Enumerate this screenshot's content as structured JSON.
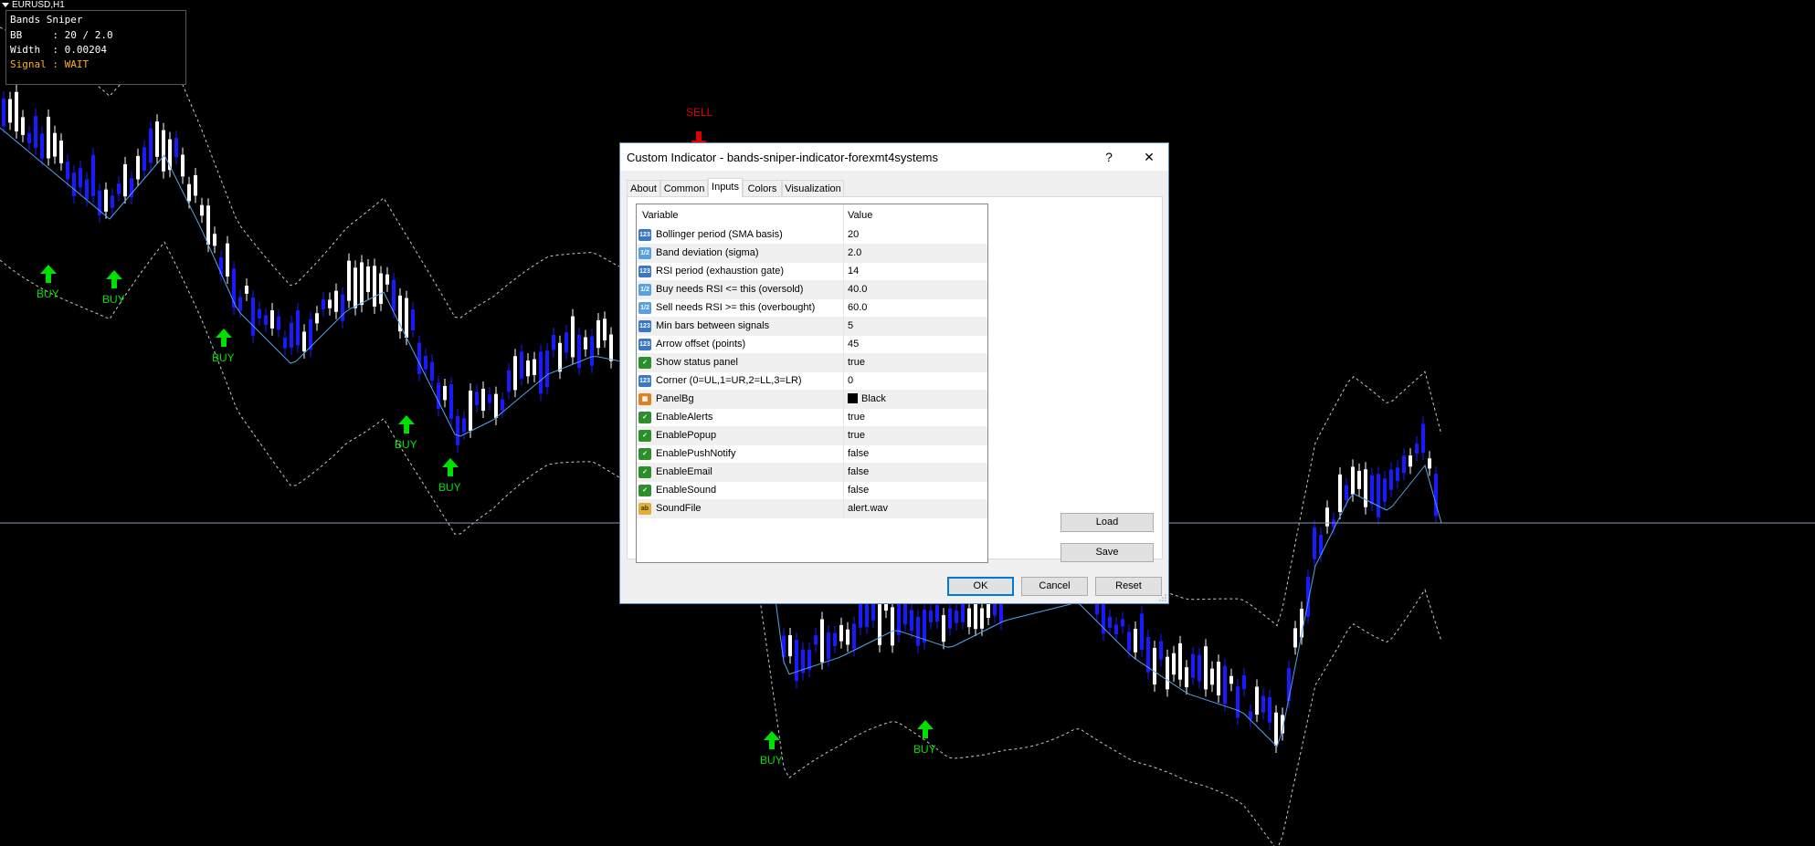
{
  "chart_header": {
    "symbol": "EURUSD,H1"
  },
  "status_panel": {
    "title": "Bands Sniper",
    "bb_line": "BB     : 20 / 2.0",
    "width_line": "Width  : 0.00204",
    "signal_line": "Signal : WAIT"
  },
  "signals": {
    "buy": "BUY",
    "sell": "SELL"
  },
  "colors": {
    "buy_arrow": "#00e000",
    "sell_arrow": "#e00000",
    "bull_candle": "#ffffff",
    "bear_candle": "#1a1aff",
    "ma_line": "#5aa0e6",
    "bands": "#c8c8c8",
    "signal_wait": "#ffb020"
  },
  "dialog": {
    "title": "Custom Indicator - bands-sniper-indicator-forexmt4systems",
    "help_label": "?",
    "close_label": "✕",
    "tabs": [
      "About",
      "Common",
      "Inputs",
      "Colors",
      "Visualization"
    ],
    "active_tab": "Inputs",
    "columns": {
      "variable": "Variable",
      "value": "Value"
    },
    "rows": [
      {
        "icon": "123",
        "type": "num",
        "name": "Bollinger period (SMA basis)",
        "value": "20"
      },
      {
        "icon": "1/2",
        "type": "dbl",
        "name": "Band deviation (sigma)",
        "value": "2.0"
      },
      {
        "icon": "123",
        "type": "num",
        "name": "RSI period (exhaustion gate)",
        "value": "14"
      },
      {
        "icon": "1/2",
        "type": "dbl",
        "name": "Buy needs RSI <= this (oversold)",
        "value": "40.0"
      },
      {
        "icon": "1/2",
        "type": "dbl",
        "name": "Sell needs RSI >= this (overbought)",
        "value": "60.0"
      },
      {
        "icon": "123",
        "type": "num",
        "name": "Min bars between signals",
        "value": "5"
      },
      {
        "icon": "123",
        "type": "num",
        "name": "Arrow offset (points)",
        "value": "45"
      },
      {
        "icon": "✓",
        "type": "bool",
        "name": "Show status panel",
        "value": "true"
      },
      {
        "icon": "123",
        "type": "num",
        "name": "Corner (0=UL,1=UR,2=LL,3=LR)",
        "value": "0"
      },
      {
        "icon": "▦",
        "type": "col",
        "name": "PanelBg",
        "value": "Black",
        "swatch": "#000000"
      },
      {
        "icon": "✓",
        "type": "bool",
        "name": "EnableAlerts",
        "value": "true"
      },
      {
        "icon": "✓",
        "type": "bool",
        "name": "EnablePopup",
        "value": "true"
      },
      {
        "icon": "✓",
        "type": "bool",
        "name": "EnablePushNotify",
        "value": "false"
      },
      {
        "icon": "✓",
        "type": "bool",
        "name": "EnableEmail",
        "value": "false"
      },
      {
        "icon": "✓",
        "type": "bool",
        "name": "EnableSound",
        "value": "false"
      },
      {
        "icon": "ab",
        "type": "str",
        "name": "SoundFile",
        "value": "alert.wav"
      }
    ],
    "load_label": "Load",
    "save_label": "Save",
    "ok_label": "OK",
    "cancel_label": "Cancel",
    "reset_label": "Reset"
  }
}
